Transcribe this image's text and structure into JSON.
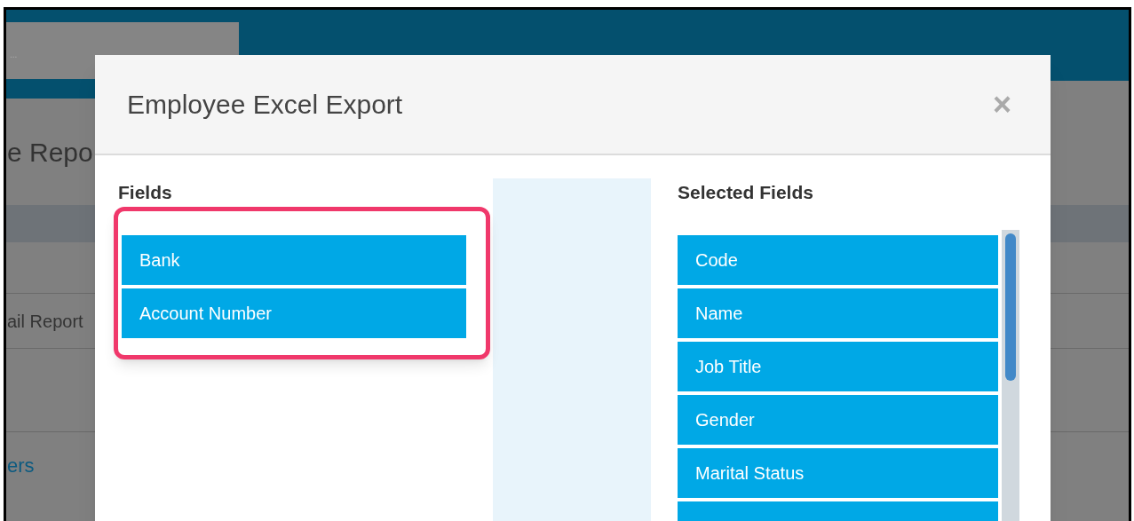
{
  "background": {
    "search_placeholder": "...",
    "page_title": "e Repo",
    "row_text": "ail Report",
    "link_text": "ers"
  },
  "dialog": {
    "title": "Employee Excel Export",
    "close": "×",
    "fields": {
      "label": "Fields",
      "items": [
        "Bank",
        "Account Number"
      ]
    },
    "selected_fields": {
      "label": "Selected Fields",
      "items": [
        "Code",
        "Name",
        "Job Title",
        "Gender",
        "Marital Status"
      ]
    }
  }
}
